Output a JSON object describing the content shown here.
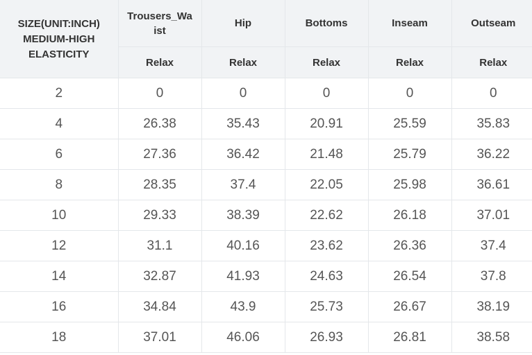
{
  "table": {
    "corner_header": "SIZE(UNIT:INCH) MEDIUM-HIGH ELASTICITY",
    "columns": [
      {
        "name": "Trousers_Waist",
        "sub": "Relax"
      },
      {
        "name": "Hip",
        "sub": "Relax"
      },
      {
        "name": "Bottoms",
        "sub": "Relax"
      },
      {
        "name": "Inseam",
        "sub": "Relax"
      },
      {
        "name": "Outseam",
        "sub": "Relax"
      }
    ],
    "rows": [
      {
        "size": "2",
        "values": [
          "0",
          "0",
          "0",
          "0",
          "0"
        ]
      },
      {
        "size": "4",
        "values": [
          "26.38",
          "35.43",
          "20.91",
          "25.59",
          "35.83"
        ]
      },
      {
        "size": "6",
        "values": [
          "27.36",
          "36.42",
          "21.48",
          "25.79",
          "36.22"
        ]
      },
      {
        "size": "8",
        "values": [
          "28.35",
          "37.4",
          "22.05",
          "25.98",
          "36.61"
        ]
      },
      {
        "size": "10",
        "values": [
          "29.33",
          "38.39",
          "22.62",
          "26.18",
          "37.01"
        ]
      },
      {
        "size": "12",
        "values": [
          "31.1",
          "40.16",
          "23.62",
          "26.36",
          "37.4"
        ]
      },
      {
        "size": "14",
        "values": [
          "32.87",
          "41.93",
          "24.63",
          "26.54",
          "37.8"
        ]
      },
      {
        "size": "16",
        "values": [
          "34.84",
          "43.9",
          "25.73",
          "26.67",
          "38.19"
        ]
      },
      {
        "size": "18",
        "values": [
          "37.01",
          "46.06",
          "26.93",
          "26.81",
          "38.58"
        ]
      }
    ]
  }
}
